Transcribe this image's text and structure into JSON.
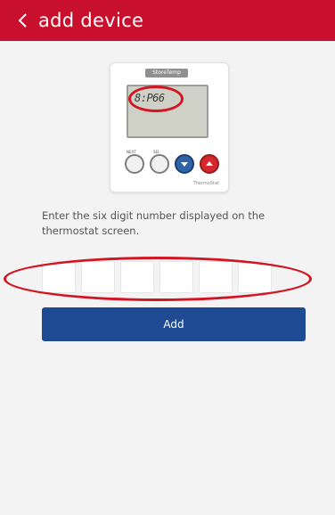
{
  "header": {
    "back_icon": "chevron-left-icon",
    "title": "add device"
  },
  "device": {
    "brand": "StoreTemp",
    "lcd_reading": "8:P66",
    "buttons": [
      {
        "label": "NEXT",
        "icon": "none"
      },
      {
        "label": "SEL",
        "icon": "none"
      },
      {
        "label": "",
        "icon": "arrow-down-icon"
      },
      {
        "label": "",
        "icon": "arrow-up-icon"
      }
    ],
    "footer": "ThermoStat"
  },
  "instruction": "Enter the six digit number displayed on the thermostat screen.",
  "code": {
    "digits": [
      "",
      "",
      "",
      "",
      "",
      ""
    ]
  },
  "add_button": {
    "label": "Add"
  },
  "colors": {
    "header": "#c8102e",
    "button": "#1f4b95",
    "highlight": "#d21522",
    "background": "#f4f3f4"
  }
}
